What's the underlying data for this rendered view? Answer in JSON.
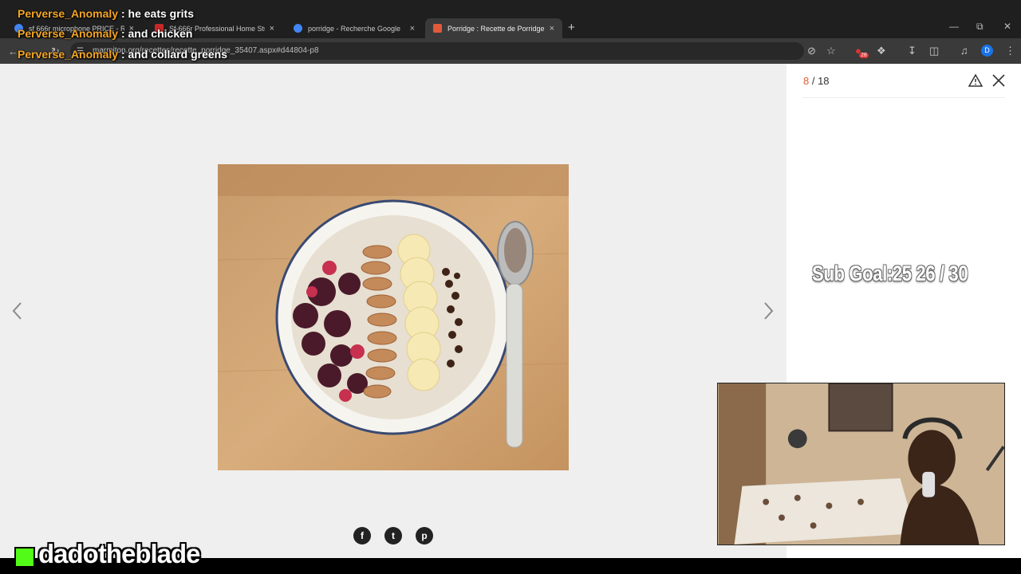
{
  "browser": {
    "tabs": [
      {
        "title": "sf 666r microphone PRICE - Re",
        "favicon_color": "#4285f4",
        "active": false
      },
      {
        "title": "Sf-666r Professional Home Stud",
        "favicon_color": "#c62828",
        "active": false
      },
      {
        "title": "porridge - Recherche Google",
        "favicon_color": "#4285f4",
        "active": false
      },
      {
        "title": "Porridge : Recette de Porridge",
        "favicon_color": "#e05a3a",
        "active": true
      }
    ],
    "tab_close": "×",
    "new_tab": "+",
    "url": "marmiton.org/recettes/recette_porridge_35407.aspx#d44804-p8",
    "extensions_badge": "28",
    "profile_initial": "D"
  },
  "gallery": {
    "current": "8",
    "separator": " / ",
    "total": "18",
    "image_alt": "Porridge bowl with berries, almonds, banana and chocolate chips"
  },
  "social": {
    "facebook": "f",
    "twitter": "t",
    "pinterest": "p"
  },
  "stream": {
    "chat": [
      {
        "user": "Perverse_Anomaly",
        "message": " : he eats grits"
      },
      {
        "user": "Perverse_Anomaly",
        "message": " : and chicken"
      },
      {
        "user": "Perverse_Anomaly",
        "message": " : and collard greens"
      }
    ],
    "sub_goal": "Sub Goal:25  26 / 30",
    "channel": "dadotheblade"
  },
  "colors": {
    "accent": "#e05a3a",
    "kick_green": "#53fc18",
    "chat_user": "#f5a623"
  }
}
